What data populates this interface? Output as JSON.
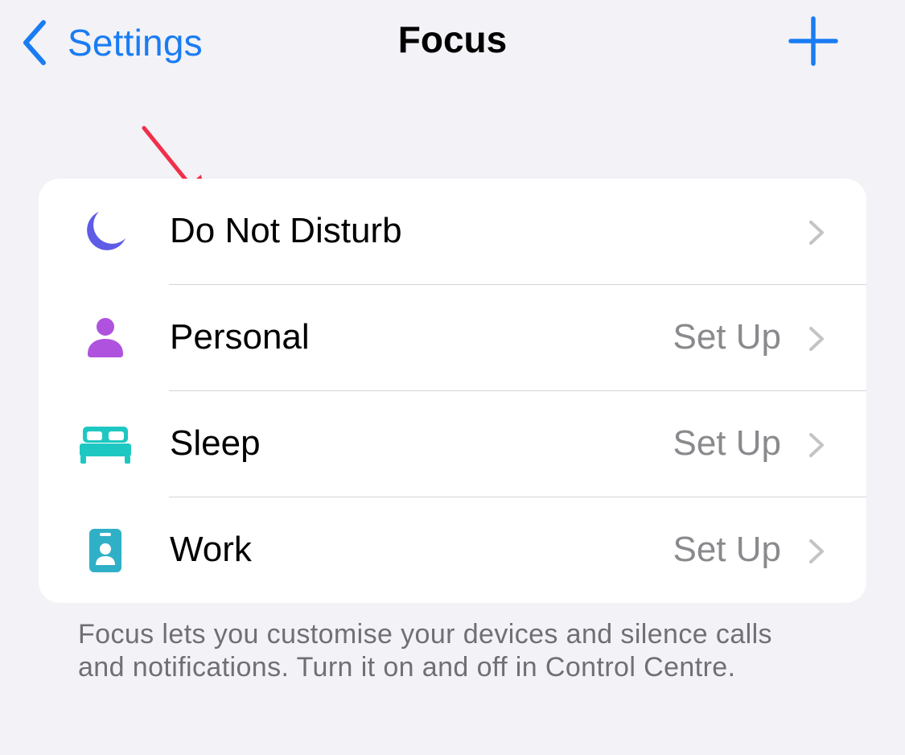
{
  "nav": {
    "back_label": "Settings",
    "title": "Focus",
    "add_icon": "plus-icon",
    "back_icon": "chevron-left-icon"
  },
  "focus_modes": [
    {
      "label": "Do Not Disturb",
      "detail": "",
      "icon": "moon-icon",
      "color": "#5e5ce6"
    },
    {
      "label": "Personal",
      "detail": "Set Up",
      "icon": "person-icon",
      "color": "#af52de"
    },
    {
      "label": "Sleep",
      "detail": "Set Up",
      "icon": "bed-icon",
      "color": "#1ec8c2"
    },
    {
      "label": "Work",
      "detail": "Set Up",
      "icon": "id-badge-icon",
      "color": "#30b0c7"
    }
  ],
  "footer_text": "Focus lets you customise your devices and silence calls and notifications. Turn it on and off in Control Centre.",
  "colors": {
    "accent": "#1a7cf3",
    "background": "#f2f2f7",
    "annotation_arrow": "#f0304a"
  }
}
